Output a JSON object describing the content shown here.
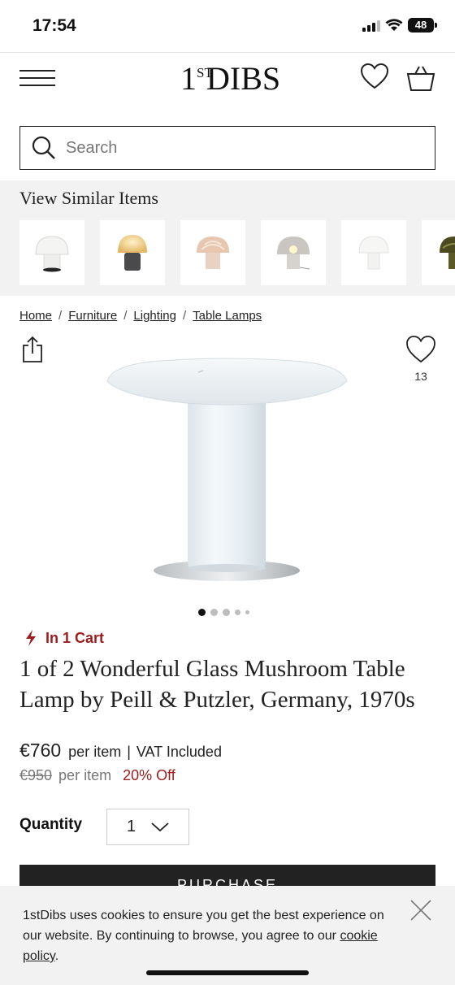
{
  "status_bar": {
    "time": "17:54",
    "battery": "48"
  },
  "header": {
    "logo_main": "DIBS",
    "logo_num": "1",
    "logo_st": "ST"
  },
  "search": {
    "placeholder": "Search"
  },
  "similar": {
    "title": "View Similar Items",
    "items": [
      {
        "name": "white-mushroom-lamp"
      },
      {
        "name": "amber-mushroom-lamp"
      },
      {
        "name": "swirl-mushroom-lamp"
      },
      {
        "name": "clear-mushroom-lamp"
      },
      {
        "name": "frosted-mushroom-lamp"
      },
      {
        "name": "green-mushroom-lamp"
      }
    ]
  },
  "breadcrumb": {
    "home": "Home",
    "furniture": "Furniture",
    "lighting": "Lighting",
    "table_lamps": "Table Lamps",
    "separator": "/"
  },
  "favorites": {
    "count": "13"
  },
  "carousel": {
    "total": 5,
    "active": 1
  },
  "cart_note": "In 1 Cart",
  "product": {
    "title": "1 of 2 Wonderful Glass Mushroom Table Lamp by Peill & Putzler, Germany, 1970s",
    "price": "€760",
    "price_unit": "per item",
    "vat": "VAT Included",
    "vat_separator": "|",
    "old_price": "€950",
    "old_unit": "per item",
    "discount": "20% Off"
  },
  "quantity": {
    "label": "Quantity",
    "value": "1"
  },
  "purchase_label": "PURCHASE",
  "cookie": {
    "text": "1stDibs uses cookies to ensure you get the best experience on our website. By continuing to browse, you agree to our ",
    "link": "cookie policy",
    "end": "."
  },
  "colors": {
    "accent_red": "#9b1c1c",
    "text": "#222222",
    "panel": "#f2f2f2"
  }
}
